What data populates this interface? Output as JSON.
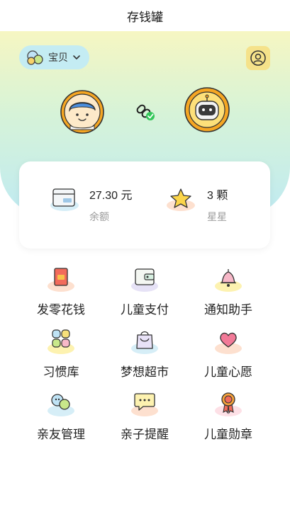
{
  "header": {
    "title": "存钱罐"
  },
  "child_selector": {
    "name": "宝贝",
    "icon": "child-avatar-icon",
    "chevron": "chevron-down-icon"
  },
  "profile": {
    "icon": "user-icon"
  },
  "link": {
    "icon": "link-check-icon"
  },
  "balance": {
    "value": "27.30 元",
    "label": "余额",
    "icon": "wallet-card-icon"
  },
  "stars": {
    "value": "3 颗",
    "label": "星星",
    "icon": "star-icon"
  },
  "features": [
    {
      "label": "发零花钱",
      "icon": "red-envelope-icon"
    },
    {
      "label": "儿童支付",
      "icon": "wallet-icon"
    },
    {
      "label": "通知助手",
      "icon": "bell-icon"
    },
    {
      "label": "习惯库",
      "icon": "blocks-icon"
    },
    {
      "label": "梦想超市",
      "icon": "shopping-bag-icon"
    },
    {
      "label": "儿童心愿",
      "icon": "heart-icon"
    },
    {
      "label": "亲友管理",
      "icon": "friends-icon"
    },
    {
      "label": "亲子提醒",
      "icon": "message-icon"
    },
    {
      "label": "儿童勋章",
      "icon": "medal-icon"
    }
  ],
  "colors": {
    "accent_yellow": "#f5a623",
    "pill_bg": "#c4ecf3",
    "profile_bg": "#f5e28a"
  }
}
